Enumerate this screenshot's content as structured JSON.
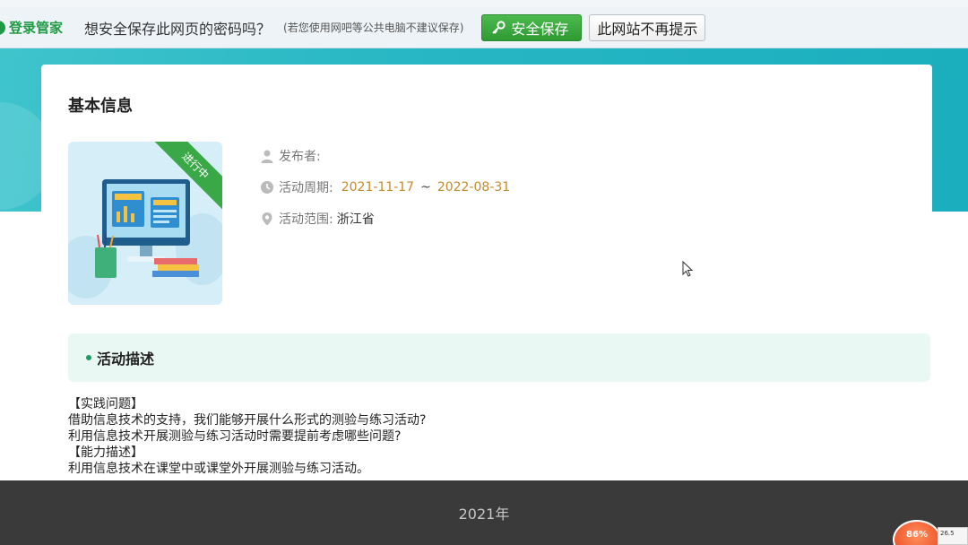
{
  "password_bar": {
    "brand": "登录管家",
    "question": "想安全保存此网页的密码吗？",
    "hint": "(若您使用网吧等公共电脑不建议保存)",
    "save_button": "安全保存",
    "never_button": "此网站不再提示",
    "brand_color": "#1f9b45"
  },
  "card": {
    "section_title": "基本信息",
    "status_ribbon": "进行中",
    "publisher_label": "发布者:",
    "period_label": "活动周期:",
    "period_start": "2021-11-17",
    "period_separator": "~",
    "period_end": "2022-08-31",
    "scope_label": "活动范围:",
    "scope_value": "浙江省",
    "description_title": "活动描述",
    "description_lines": [
      "【实践问题】",
      "借助信息技术的支持，我们能够开展什么形式的测验与练习活动?",
      "利用信息技术开展测验与练习活动时需要提前考虑哪些问题?",
      "【能力描述】",
      "利用信息技术在课堂中或课堂外开展测验与练习活动。"
    ],
    "accent_date_color": "#c48a2c",
    "ribbon_color": "#3aa847"
  },
  "overlay": {
    "year": "2021年",
    "speed_value": "86%",
    "speed_label": "26.5"
  },
  "icons": {
    "publisher": "user-icon",
    "period": "clock-icon",
    "scope": "location-pin-icon",
    "save_key": "key-icon"
  }
}
